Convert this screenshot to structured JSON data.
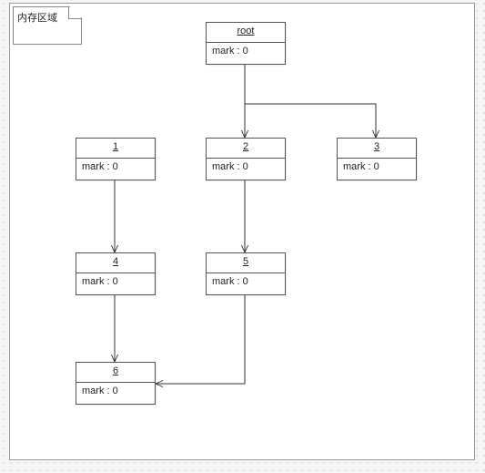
{
  "region_label": "内存区域",
  "nodes": {
    "root": {
      "title": "root",
      "mark": "mark : 0"
    },
    "n1": {
      "title": "1",
      "mark": "mark : 0"
    },
    "n2": {
      "title": "2",
      "mark": "mark : 0"
    },
    "n3": {
      "title": "3",
      "mark": "mark : 0"
    },
    "n4": {
      "title": "4",
      "mark": "mark : 0"
    },
    "n5": {
      "title": "5",
      "mark": "mark : 0"
    },
    "n6": {
      "title": "6",
      "mark": "mark : 0"
    }
  },
  "chart_data": {
    "type": "diagram",
    "title": "内存区域",
    "nodes": [
      {
        "id": "root",
        "label": "root",
        "mark": 0
      },
      {
        "id": "1",
        "label": "1",
        "mark": 0
      },
      {
        "id": "2",
        "label": "2",
        "mark": 0
      },
      {
        "id": "3",
        "label": "3",
        "mark": 0
      },
      {
        "id": "4",
        "label": "4",
        "mark": 0
      },
      {
        "id": "5",
        "label": "5",
        "mark": 0
      },
      {
        "id": "6",
        "label": "6",
        "mark": 0
      }
    ],
    "edges": [
      {
        "from": "root",
        "to": "2"
      },
      {
        "from": "root",
        "to": "3"
      },
      {
        "from": "1",
        "to": "4"
      },
      {
        "from": "2",
        "to": "5"
      },
      {
        "from": "4",
        "to": "6"
      },
      {
        "from": "5",
        "to": "6"
      }
    ]
  }
}
